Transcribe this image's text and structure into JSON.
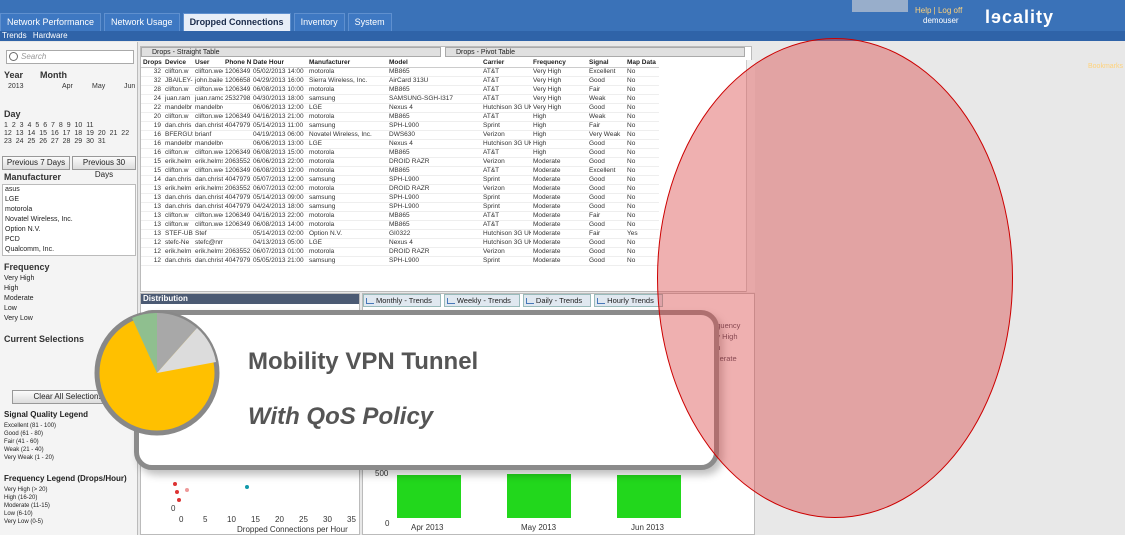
{
  "tabs": [
    {
      "label": "Network Performance"
    },
    {
      "label": "Network Usage"
    },
    {
      "label": "Dropped Connections"
    },
    {
      "label": "Inventory"
    },
    {
      "label": "System"
    }
  ],
  "subnav": [
    "Trends",
    "Hardware"
  ],
  "header": {
    "help_links": "Help | Log off",
    "user": "demouser",
    "logo": "lɘcality",
    "bookmarks": "Bookmarks"
  },
  "search": {
    "placeholder": "Search"
  },
  "date": {
    "year_label": "Year",
    "month_label": "Month",
    "year": "2013",
    "months": [
      "Apr",
      "May",
      "Jun"
    ],
    "day_label": "Day",
    "days_row1": "1  2  3  4  5  6  7  8  9  10  11",
    "days_row2": "12 13 14 15 16 17 18 19 20 21 22",
    "days_row3": "23 24 25 26 27 28 29 30 31",
    "prev7": "Previous 7 Days",
    "prev30": "Previous 30 Days"
  },
  "manufacturer": {
    "label": "Manufacturer",
    "items": [
      "asus",
      "LGE",
      "motorola",
      "Novatel Wireless, Inc.",
      "Option N.V.",
      "PCD",
      "Qualcomm, Inc."
    ]
  },
  "frequency": {
    "label": "Frequency",
    "items": [
      "Very High",
      "High",
      "Moderate",
      "Low",
      "Very Low"
    ]
  },
  "current_selections": {
    "label": "Current Selections",
    "clear": "Clear All Selections"
  },
  "signal_legend": {
    "title": "Signal Quality Legend",
    "items": [
      "Excellent (81 - 100)",
      "Good (61 - 80)",
      "Fair (41 - 60)",
      "Weak (21 - 40)",
      "Very Weak (1 - 20)"
    ]
  },
  "freq_legend": {
    "title": "Frequency Legend (Drops/Hour)",
    "items": [
      "Very High (> 20)",
      "High (16-20)",
      "Moderate (11-15)",
      "Low (6-10)",
      "Very Low (0-5)"
    ]
  },
  "table": {
    "title_straight": "Drops - Straight Table",
    "title_pivot": "Drops - Pivot Table",
    "columns": [
      "Drops",
      "Device",
      "User",
      "Phone N",
      "Date Hour",
      "Manufacturer",
      "Model",
      "Carrier",
      "Frequency",
      "Signal",
      "Map Data"
    ],
    "rows": [
      [
        "32",
        "clifton.w",
        "clifton.wee",
        "1206349",
        "05/02/2013 14:00",
        "motorola",
        "MB865",
        "AT&T",
        "Very High",
        "Excellent",
        "No"
      ],
      [
        "32",
        "JBAILEY-",
        "john.bailey",
        "1206658",
        "04/29/2013 16:00",
        "Sierra Wireless, Inc.",
        "AirCard 313U",
        "AT&T",
        "Very High",
        "Good",
        "No"
      ],
      [
        "28",
        "clifton.w",
        "clifton.wee",
        "1206349",
        "06/08/2013 10:00",
        "motorola",
        "MB865",
        "AT&T",
        "Very High",
        "Fair",
        "No"
      ],
      [
        "24",
        "juan.ram",
        "juan.ramor",
        "2532798",
        "04/30/2013 18:00",
        "samsung",
        "SAMSUNG-SGH-I317",
        "AT&T",
        "Very High",
        "Weak",
        "No"
      ],
      [
        "22",
        "mandelbr",
        "mandelbro",
        "",
        "06/06/2013 12:00",
        "LGE",
        "Nexus 4",
        "Hutchison 3G UK L",
        "Very High",
        "Good",
        "No"
      ],
      [
        "20",
        "clifton.w",
        "clifton.wee",
        "1206349",
        "04/16/2013 21:00",
        "motorola",
        "MB865",
        "AT&T",
        "High",
        "Weak",
        "No"
      ],
      [
        "19",
        "dan.chris",
        "dan.christ",
        "4047979",
        "05/14/2013 11:00",
        "samsung",
        "SPH-L900",
        "Sprint",
        "High",
        "Fair",
        "No"
      ],
      [
        "16",
        "BFERGUS",
        "brianf",
        "",
        "04/19/2013 06:00",
        "Novatel Wireless, Inc.",
        "DWS630",
        "Verizon",
        "High",
        "Very Weak",
        "No"
      ],
      [
        "16",
        "mandelbr",
        "mandelbro",
        "",
        "06/06/2013 13:00",
        "LGE",
        "Nexus 4",
        "Hutchison 3G UK L",
        "High",
        "Good",
        "No"
      ],
      [
        "16",
        "clifton.w",
        "clifton.wee",
        "1206349",
        "06/08/2013 15:00",
        "motorola",
        "MB865",
        "AT&T",
        "High",
        "Good",
        "No"
      ],
      [
        "15",
        "erik.helm",
        "erik.helms",
        "2063552",
        "06/06/2013 22:00",
        "motorola",
        "DROID RAZR",
        "Verizon",
        "Moderate",
        "Good",
        "No"
      ],
      [
        "15",
        "clifton.w",
        "clifton.wee",
        "1206349",
        "06/08/2013 12:00",
        "motorola",
        "MB865",
        "AT&T",
        "Moderate",
        "Excellent",
        "No"
      ],
      [
        "14",
        "dan.chris",
        "dan.christ",
        "4047979",
        "05/07/2013 12:00",
        "samsung",
        "SPH-L900",
        "Sprint",
        "Moderate",
        "Good",
        "No"
      ],
      [
        "13",
        "erik.helm",
        "erik.helms",
        "2063552",
        "06/07/2013 02:00",
        "motorola",
        "DROID RAZR",
        "Verizon",
        "Moderate",
        "Good",
        "No"
      ],
      [
        "13",
        "dan.chris",
        "dan.christ",
        "4047979",
        "05/14/2013 09:00",
        "samsung",
        "SPH-L900",
        "Sprint",
        "Moderate",
        "Good",
        "No"
      ],
      [
        "13",
        "dan.chris",
        "dan.christ",
        "4047979",
        "04/24/2013 18:00",
        "samsung",
        "SPH-L900",
        "Sprint",
        "Moderate",
        "Good",
        "No"
      ],
      [
        "13",
        "clifton.w",
        "clifton.wee",
        "1206349",
        "04/16/2013 22:00",
        "motorola",
        "MB865",
        "AT&T",
        "Moderate",
        "Fair",
        "No"
      ],
      [
        "13",
        "clifton.w",
        "clifton.wee",
        "1206349",
        "06/08/2013 14:00",
        "motorola",
        "MB865",
        "AT&T",
        "Moderate",
        "Good",
        "No"
      ],
      [
        "13",
        "STEF-UB",
        "Stef",
        "",
        "05/14/2013 02:00",
        "Option N.V.",
        "GI0322",
        "Hutchison 3G UK L",
        "Moderate",
        "Fair",
        "Yes"
      ],
      [
        "12",
        "stefc-Ne",
        "stefc@nm",
        "",
        "04/13/2013 05:00",
        "LGE",
        "Nexus 4",
        "Hutchison 3G UK L",
        "Moderate",
        "Good",
        "No"
      ],
      [
        "12",
        "erik.helm",
        "erik.helms",
        "2063552",
        "06/07/2013 01:00",
        "motorola",
        "DROID RAZR",
        "Verizon",
        "Moderate",
        "Good",
        "No"
      ],
      [
        "12",
        "dan.chris",
        "dan.christ",
        "4047979",
        "05/05/2013 21:00",
        "samsung",
        "SPH-L900",
        "Sprint",
        "Moderate",
        "Good",
        "No"
      ]
    ]
  },
  "distribution": {
    "title": "Distribution",
    "x_label": "Dropped Connections per Hour",
    "x_ticks": [
      "0",
      "5",
      "10",
      "15",
      "20",
      "25",
      "30",
      "35"
    ],
    "y_tick": "0"
  },
  "trends": {
    "tabs": [
      "Monthly - Trends",
      "Weekly - Trends",
      "Daily - Trends",
      "Hourly Trends"
    ],
    "x_labels": [
      "Apr 2013",
      "May 2013",
      "Jun 2013"
    ],
    "y_ticks": [
      "500",
      "0"
    ],
    "legend_behind": [
      "Frequency",
      "Very High",
      "High",
      "Moderate",
      "Low"
    ]
  },
  "chart_data": {
    "type": "bar",
    "categories": [
      "Apr 2013",
      "May 2013",
      "Jun 2013"
    ],
    "values": [
      430,
      440,
      430
    ],
    "ylim": [
      0,
      500
    ]
  },
  "popup": {
    "headline": "Mobility VPN Tunnel",
    "subline": "With QoS Policy"
  },
  "colors": {
    "nav": "#3a72b8",
    "bar": "#22d71c",
    "pie_main": "#ffc000",
    "overlay": "#dc5050"
  }
}
